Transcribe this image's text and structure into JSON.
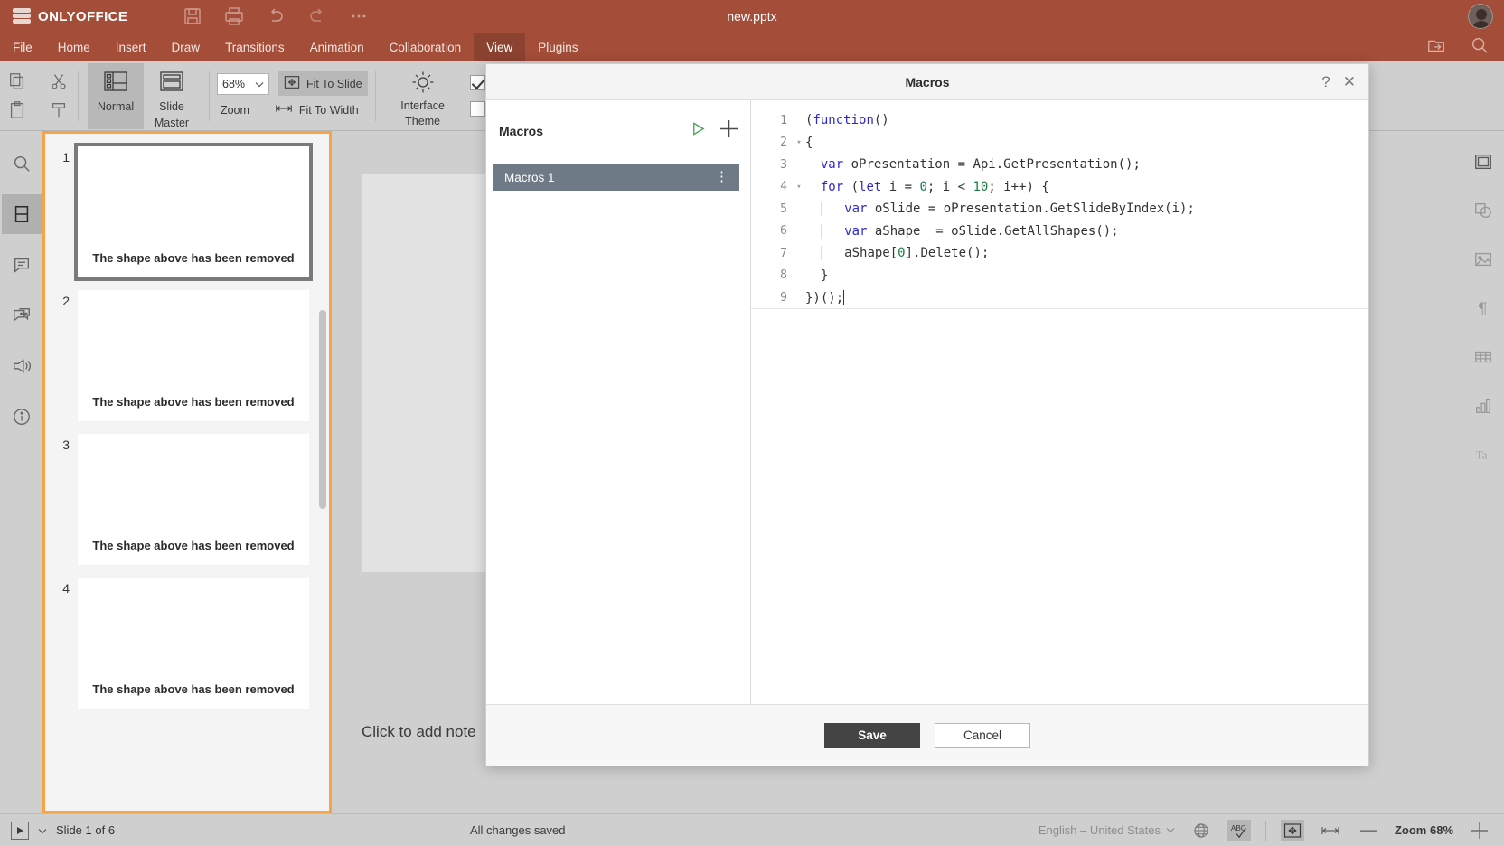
{
  "titlebar": {
    "brand": "ONLYOFFICE",
    "document_title": "new.pptx",
    "icons": [
      "save-icon",
      "print-icon",
      "undo-icon",
      "redo-icon",
      "more-icon"
    ],
    "avatar": "user-avatar"
  },
  "menubar": {
    "items": [
      {
        "label": "File",
        "active": false
      },
      {
        "label": "Home",
        "active": false
      },
      {
        "label": "Insert",
        "active": false
      },
      {
        "label": "Draw",
        "active": false
      },
      {
        "label": "Transitions",
        "active": false
      },
      {
        "label": "Animation",
        "active": false
      },
      {
        "label": "Collaboration",
        "active": false
      },
      {
        "label": "View",
        "active": true
      },
      {
        "label": "Plugins",
        "active": false
      }
    ],
    "right_icons": [
      "open-file-location-icon",
      "search-icon"
    ]
  },
  "ribbon": {
    "clipboard_icons": [
      "copy-icon",
      "cut-icon",
      "paste-icon",
      "format-painter-icon"
    ],
    "normal_label": "Normal",
    "slide_master_label": "Slide\nMaster",
    "slide_master_line1": "Slide",
    "slide_master_line2": "Master",
    "zoom_value": "68%",
    "zoom_caption": "Zoom",
    "fit_to_slide": "Fit To Slide",
    "fit_to_width": "Fit To Width",
    "interface_theme_line1": "Interface",
    "interface_theme_line2": "Theme"
  },
  "left_rail": {
    "items": [
      {
        "name": "search-icon",
        "selected": false
      },
      {
        "name": "slides-icon",
        "selected": true
      },
      {
        "name": "comments-icon",
        "selected": false
      },
      {
        "name": "chat-icon",
        "selected": false
      },
      {
        "name": "feedback-icon",
        "selected": false
      },
      {
        "name": "about-icon",
        "selected": false
      }
    ]
  },
  "right_rail": {
    "items": [
      {
        "name": "slide-settings-icon",
        "selected": true
      },
      {
        "name": "shape-settings-icon",
        "selected": false
      },
      {
        "name": "image-settings-icon",
        "selected": false
      },
      {
        "name": "paragraph-settings-icon",
        "selected": false
      },
      {
        "name": "table-settings-icon",
        "selected": false
      },
      {
        "name": "chart-settings-icon",
        "selected": false
      },
      {
        "name": "text-art-settings-icon",
        "selected": false
      }
    ]
  },
  "thumbnails": {
    "slides": [
      {
        "number": "1",
        "caption": "The shape above has been removed",
        "selected": true
      },
      {
        "number": "2",
        "caption": "The shape above has been removed",
        "selected": false
      },
      {
        "number": "3",
        "caption": "The shape above has been removed",
        "selected": false
      },
      {
        "number": "4",
        "caption": "The shape above has been removed",
        "selected": false
      }
    ]
  },
  "canvas": {
    "notes_placeholder": "Click to add note"
  },
  "statusbar": {
    "slide_count_label": "Slide 1 of 6",
    "save_status": "All changes saved",
    "language": "English – United States",
    "zoom_label": "Zoom 68%",
    "icons": [
      "start-slideshow-icon",
      "set-language-icon",
      "spell-checking-icon",
      "fit-to-slide-icon",
      "fit-to-width-icon",
      "zoom-out-icon",
      "zoom-in-icon"
    ]
  },
  "macros_dialog": {
    "title": "Macros",
    "help_icon": "?",
    "close_icon": "✕",
    "list_header": "Macros",
    "run_icon": "run-macro-icon",
    "add_icon": "add-macro-icon",
    "items": [
      {
        "label": "Macros 1",
        "selected": true
      }
    ],
    "save_label": "Save",
    "cancel_label": "Cancel",
    "code": {
      "lines": [
        {
          "n": "1",
          "fold": "",
          "indent": 0,
          "guide": false,
          "tokens": [
            {
              "t": "(",
              "c": "plain"
            },
            {
              "t": "function",
              "c": "kw"
            },
            {
              "t": "()",
              "c": "plain"
            }
          ]
        },
        {
          "n": "2",
          "fold": "▾",
          "indent": 0,
          "guide": false,
          "tokens": [
            {
              "t": "{",
              "c": "plain"
            }
          ]
        },
        {
          "n": "3",
          "fold": "",
          "indent": 1,
          "guide": false,
          "tokens": [
            {
              "t": "var",
              "c": "kw"
            },
            {
              "t": " oPresentation = Api.GetPresentation();",
              "c": "plain"
            }
          ]
        },
        {
          "n": "4",
          "fold": "▾",
          "indent": 1,
          "guide": false,
          "tokens": [
            {
              "t": "for",
              "c": "kw"
            },
            {
              "t": " (",
              "c": "plain"
            },
            {
              "t": "let",
              "c": "kw"
            },
            {
              "t": " i = ",
              "c": "plain"
            },
            {
              "t": "0",
              "c": "num"
            },
            {
              "t": "; i < ",
              "c": "plain"
            },
            {
              "t": "10",
              "c": "num"
            },
            {
              "t": "; i++) {",
              "c": "plain"
            }
          ]
        },
        {
          "n": "5",
          "fold": "",
          "indent": 2,
          "guide": true,
          "tokens": [
            {
              "t": "var",
              "c": "kw"
            },
            {
              "t": " oSlide = oPresentation.GetSlideByIndex(i);",
              "c": "plain"
            }
          ]
        },
        {
          "n": "6",
          "fold": "",
          "indent": 2,
          "guide": true,
          "tokens": [
            {
              "t": "var",
              "c": "kw"
            },
            {
              "t": " aShape  = oSlide.GetAllShapes();",
              "c": "plain"
            }
          ]
        },
        {
          "n": "7",
          "fold": "",
          "indent": 2,
          "guide": true,
          "tokens": [
            {
              "t": "aShape[",
              "c": "plain"
            },
            {
              "t": "0",
              "c": "num"
            },
            {
              "t": "].Delete();",
              "c": "plain"
            }
          ]
        },
        {
          "n": "8",
          "fold": "",
          "indent": 1,
          "guide": false,
          "tokens": [
            {
              "t": "}",
              "c": "plain"
            }
          ]
        },
        {
          "n": "9",
          "fold": "",
          "indent": 0,
          "guide": false,
          "cursor": true,
          "tokens": [
            {
              "t": "})();",
              "c": "plain"
            }
          ]
        }
      ]
    }
  },
  "colors": {
    "brand": "#a44d38",
    "brand_active": "#8c4230",
    "chrome": "#cfcfcf",
    "thumb_border": "#f5a44a",
    "macro_selected": "#6e7a86",
    "keyword": "#2d29c9",
    "number": "#197d42",
    "save_button": "#444444"
  }
}
